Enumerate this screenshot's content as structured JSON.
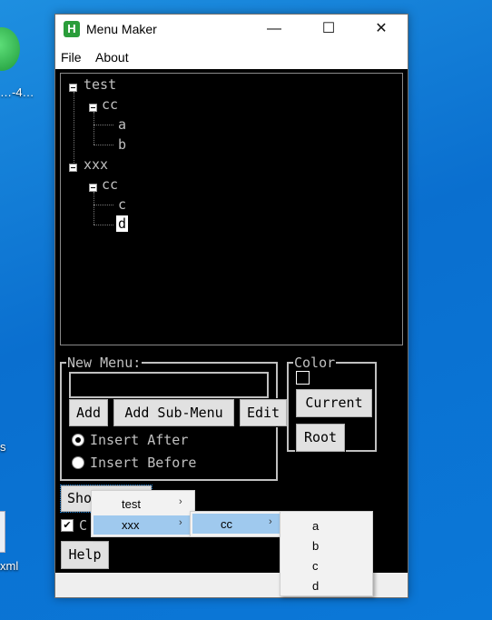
{
  "desktop": {
    "labels": [
      "…-4…",
      "s",
      "xml"
    ]
  },
  "window": {
    "title": "Menu Maker",
    "app_icon_letter": "H",
    "controls": {
      "minimize": "—",
      "maximize": "☐",
      "close": "✕"
    }
  },
  "menubar": {
    "file": "File",
    "about": "About"
  },
  "tree": {
    "nodes": [
      {
        "label": "test"
      },
      {
        "label": "cc"
      },
      {
        "label": "a"
      },
      {
        "label": "b"
      },
      {
        "label": "xxx"
      },
      {
        "label": "cc"
      },
      {
        "label": "c"
      },
      {
        "label": "d",
        "selected": true
      }
    ]
  },
  "new_menu": {
    "legend": "New Menu:",
    "input_value": "",
    "add": "Add",
    "add_sub_menu": "Add Sub-Menu",
    "edit": "Edit",
    "insert_after": "Insert After",
    "insert_before": "Insert Before",
    "selected_option": "insert_after"
  },
  "color": {
    "legend": "Color",
    "current": "Current",
    "root": "Root"
  },
  "show_button": "Show",
  "checkbox": {
    "label": "C",
    "checked": true
  },
  "help": "Help",
  "popup_menus": {
    "level1": [
      {
        "label": "test",
        "has_submenu": true
      },
      {
        "label": "xxx",
        "has_submenu": true,
        "highlighted": true
      }
    ],
    "level2": [
      {
        "label": "cc",
        "has_submenu": true,
        "highlighted": true
      }
    ],
    "level3": [
      {
        "label": "a"
      },
      {
        "label": "b"
      },
      {
        "label": "c"
      },
      {
        "label": "d"
      }
    ],
    "submenu_arrow": "›"
  },
  "colors": {
    "window_bg": "#000000",
    "text": "#c0c0c0",
    "menu_highlight": "#9fc9ee"
  }
}
